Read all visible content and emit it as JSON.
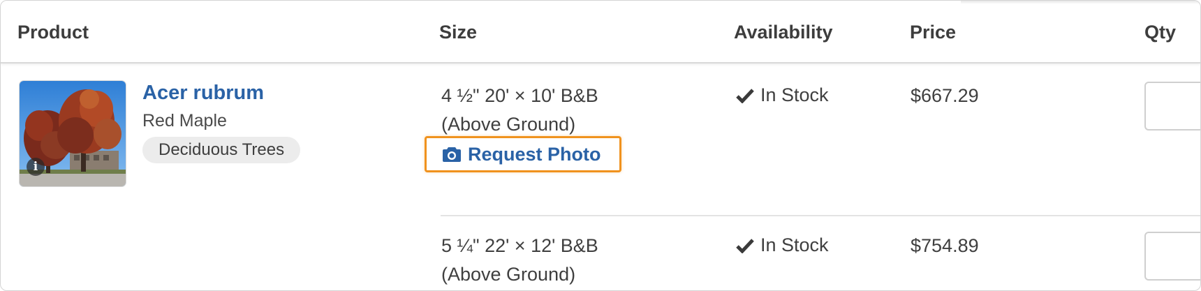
{
  "table": {
    "headers": {
      "product": "Product",
      "size": "Size",
      "availability": "Availability",
      "price": "Price",
      "qty": "Qty"
    }
  },
  "product": {
    "name": "Acer rubrum",
    "common_name": "Red Maple",
    "category": "Deciduous Trees",
    "image_icon": "info-icon",
    "info_glyph": "i"
  },
  "variants": [
    {
      "size_line1": "4 ½\" 20' × 10' B&B",
      "size_line2": "(Above Ground)",
      "request_photo_label": "Request Photo",
      "request_photo_icon": "camera-icon",
      "availability": "In Stock",
      "availability_icon": "check-icon",
      "price": "$667.29",
      "qty_value": ""
    },
    {
      "size_line1": "5 ¼\" 22' × 12' B&B",
      "size_line2": "(Above Ground)",
      "availability": "In Stock",
      "availability_icon": "check-icon",
      "price": "$754.89",
      "qty_value": ""
    }
  ],
  "colors": {
    "link_blue": "#2a62a6",
    "focus_orange": "#f0921e",
    "pill_gray": "#ececec"
  }
}
